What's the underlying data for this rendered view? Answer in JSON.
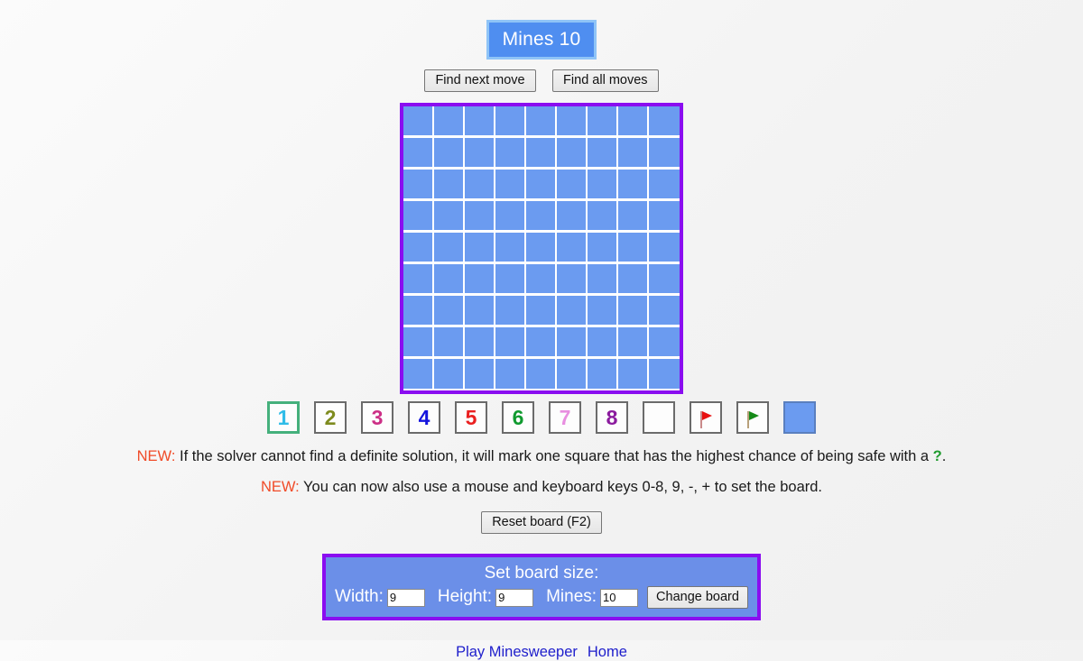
{
  "header": {
    "mines_label": "Mines 10"
  },
  "toolbar": {
    "find_next_move": "Find next move",
    "find_all_moves": "Find all moves"
  },
  "board": {
    "width": 9,
    "height": 9,
    "mines": 10,
    "border_color": "#8a0df0",
    "cell_color": "#6b9bf0",
    "grid_line_color": "#ffffff",
    "cells": [
      [
        "",
        "",
        "",
        "",
        "",
        "",
        "",
        "",
        ""
      ],
      [
        "",
        "",
        "",
        "",
        "",
        "",
        "",
        "",
        ""
      ],
      [
        "",
        "",
        "",
        "",
        "",
        "",
        "",
        "",
        ""
      ],
      [
        "",
        "",
        "",
        "",
        "",
        "",
        "",
        "",
        ""
      ],
      [
        "",
        "",
        "",
        "",
        "",
        "",
        "",
        "",
        ""
      ],
      [
        "",
        "",
        "",
        "",
        "",
        "",
        "",
        "",
        ""
      ],
      [
        "",
        "",
        "",
        "",
        "",
        "",
        "",
        "",
        ""
      ],
      [
        "",
        "",
        "",
        "",
        "",
        "",
        "",
        "",
        ""
      ],
      [
        "",
        "",
        "",
        "",
        "",
        "",
        "",
        "",
        ""
      ]
    ]
  },
  "palette": {
    "selected_index": 0,
    "selection_color": "#45b07c",
    "items": [
      {
        "name": "palette-1",
        "label": "1",
        "color": "#2fbce8",
        "kind": "number"
      },
      {
        "name": "palette-2",
        "label": "2",
        "color": "#7e8b1e",
        "kind": "number"
      },
      {
        "name": "palette-3",
        "label": "3",
        "color": "#cc2f86",
        "kind": "number"
      },
      {
        "name": "palette-4",
        "label": "4",
        "color": "#1414dd",
        "kind": "number"
      },
      {
        "name": "palette-5",
        "label": "5",
        "color": "#ea2020",
        "kind": "number"
      },
      {
        "name": "palette-6",
        "label": "6",
        "color": "#109a2f",
        "kind": "number"
      },
      {
        "name": "palette-7",
        "label": "7",
        "color": "#e88ee0",
        "kind": "number"
      },
      {
        "name": "palette-8",
        "label": "8",
        "color": "#8b1b9e",
        "kind": "number"
      },
      {
        "name": "palette-empty",
        "label": "",
        "color": "",
        "kind": "empty"
      },
      {
        "name": "palette-red-flag",
        "label": "",
        "color": "#e81010",
        "kind": "flag-red"
      },
      {
        "name": "palette-green-flag",
        "label": "",
        "color": "#158a18",
        "kind": "flag-green"
      },
      {
        "name": "palette-unknown",
        "label": "",
        "color": "#6b9bf0",
        "kind": "blue"
      }
    ]
  },
  "notices": [
    {
      "tag": "NEW:",
      "text_before": " If the solver cannot find a definite solution, it will mark one square that has the highest chance of being safe with a ",
      "highlight": "?",
      "text_after": "."
    },
    {
      "tag": "NEW:",
      "text_before": " You can now also use a mouse and keyboard keys 0-8, 9, -, + to set the board.",
      "highlight": "",
      "text_after": ""
    }
  ],
  "reset": {
    "label": "Reset board (F2)"
  },
  "size_panel": {
    "title": "Set board size:",
    "width_label": "Width:",
    "width_value": "9",
    "height_label": "Height:",
    "height_value": "9",
    "mines_label": "Mines:",
    "mines_value": "10",
    "change_label": "Change board",
    "border_color": "#8a0df0",
    "background_color": "#6b8fe8"
  },
  "footer": {
    "play_link": "Play Minesweeper",
    "home_link": "Home"
  }
}
